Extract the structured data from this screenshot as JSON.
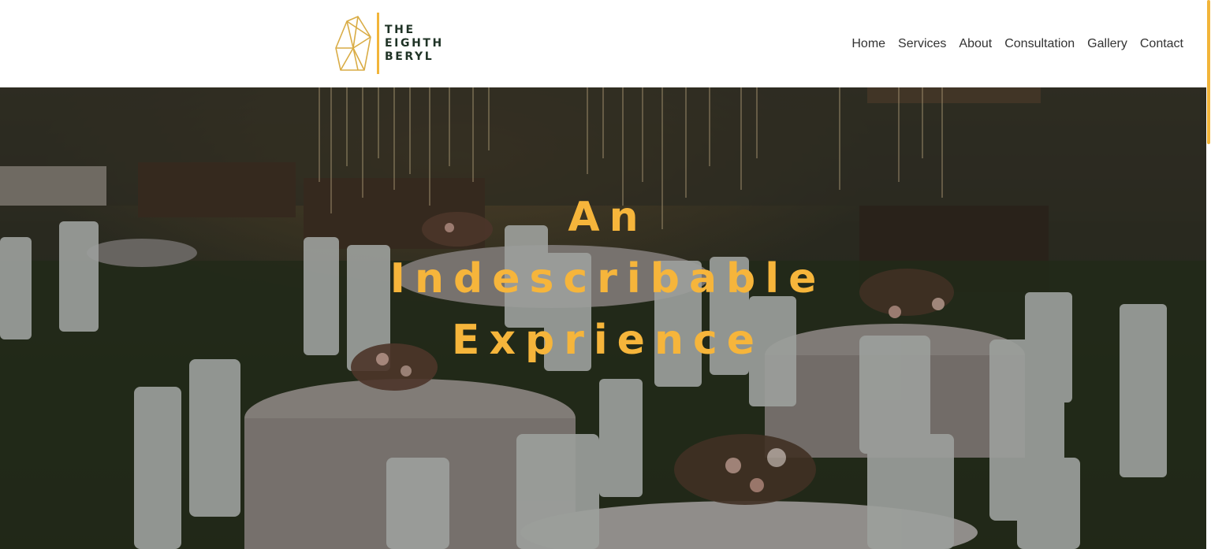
{
  "brand": {
    "name_lines": [
      "THE",
      "EIGHTH",
      "BERYL"
    ],
    "logo_icon": "gem-outline-icon",
    "accent_color": "#f2b53a",
    "text_color": "#1f3326"
  },
  "nav": {
    "items": [
      {
        "label": "Home"
      },
      {
        "label": "Services"
      },
      {
        "label": "About"
      },
      {
        "label": "Consultation"
      },
      {
        "label": "Gallery"
      },
      {
        "label": "Contact"
      }
    ]
  },
  "hero": {
    "title_lines": [
      "An",
      "Indescribable",
      "Exprience"
    ],
    "title_color": "#f6b53b",
    "background_description_icon": "outdoor-banquet-photo"
  }
}
